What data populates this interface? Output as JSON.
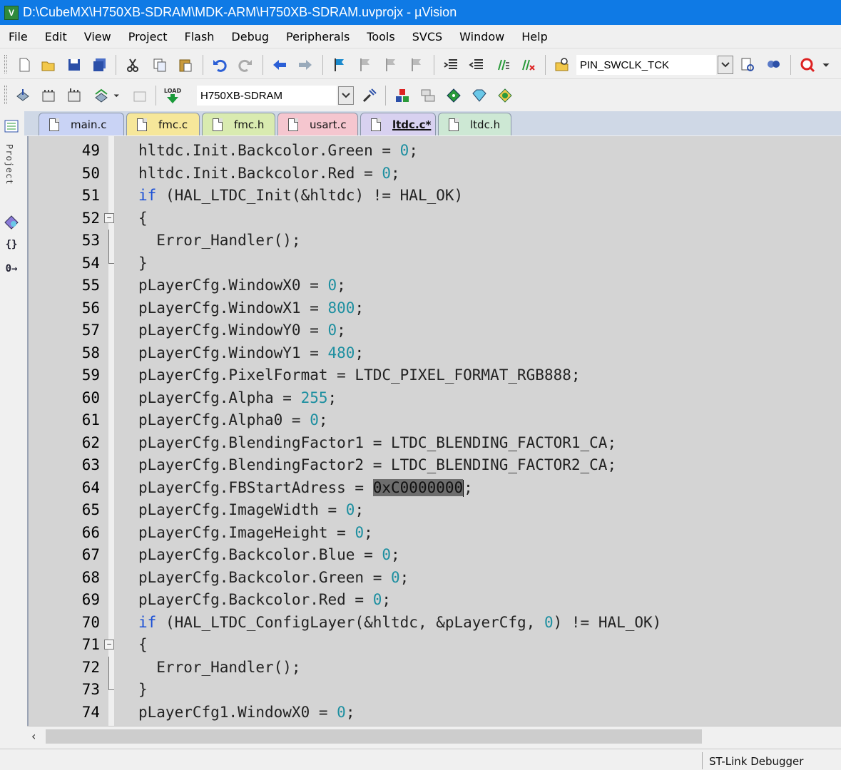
{
  "window": {
    "title": "D:\\CubeMX\\H750XB-SDRAM\\MDK-ARM\\H750XB-SDRAM.uvprojx - µVision",
    "app_icon_letter": "V"
  },
  "menu": [
    "File",
    "Edit",
    "View",
    "Project",
    "Flash",
    "Debug",
    "Peripherals",
    "Tools",
    "SVCS",
    "Window",
    "Help"
  ],
  "toolbar": {
    "find_combo_value": "PIN_SWCLK_TCK",
    "target_combo_value": "H750XB-SDRAM",
    "load_label": "LOAD"
  },
  "sidebar": {
    "project_label": "Project",
    "functions_label": "{}",
    "templates_label": "0→"
  },
  "tabs": [
    {
      "label": "main.c",
      "color": "#c9d3f5",
      "active": false
    },
    {
      "label": "fmc.c",
      "color": "#f6e79a",
      "active": false
    },
    {
      "label": "fmc.h",
      "color": "#d9ebb0",
      "active": false
    },
    {
      "label": "usart.c",
      "color": "#f5c6cf",
      "active": false
    },
    {
      "label": "ltdc.c*",
      "color": "#d8d1f0",
      "active": true
    },
    {
      "label": "ltdc.h",
      "color": "#cde8d4",
      "active": false
    }
  ],
  "code": [
    {
      "ln": "49",
      "text": "hltdc.Init.Backcolor.Green = 0;"
    },
    {
      "ln": "50",
      "text": "hltdc.Init.Backcolor.Red = 0;"
    },
    {
      "ln": "51",
      "text": "if (HAL_LTDC_Init(&hltdc) != HAL_OK)"
    },
    {
      "ln": "52",
      "text": "{"
    },
    {
      "ln": "53",
      "text": "  Error_Handler();"
    },
    {
      "ln": "54",
      "text": "}"
    },
    {
      "ln": "55",
      "text": "pLayerCfg.WindowX0 = 0;"
    },
    {
      "ln": "56",
      "text": "pLayerCfg.WindowX1 = 800;"
    },
    {
      "ln": "57",
      "text": "pLayerCfg.WindowY0 = 0;"
    },
    {
      "ln": "58",
      "text": "pLayerCfg.WindowY1 = 480;"
    },
    {
      "ln": "59",
      "text": "pLayerCfg.PixelFormat = LTDC_PIXEL_FORMAT_RGB888;"
    },
    {
      "ln": "60",
      "text": "pLayerCfg.Alpha = 255;"
    },
    {
      "ln": "61",
      "text": "pLayerCfg.Alpha0 = 0;"
    },
    {
      "ln": "62",
      "text": "pLayerCfg.BlendingFactor1 = LTDC_BLENDING_FACTOR1_CA;"
    },
    {
      "ln": "63",
      "text": "pLayerCfg.BlendingFactor2 = LTDC_BLENDING_FACTOR2_CA;"
    },
    {
      "ln": "64",
      "text": "pLayerCfg.FBStartAdress = 0xC0000000;"
    },
    {
      "ln": "65",
      "text": "pLayerCfg.ImageWidth = 0;"
    },
    {
      "ln": "66",
      "text": "pLayerCfg.ImageHeight = 0;"
    },
    {
      "ln": "67",
      "text": "pLayerCfg.Backcolor.Blue = 0;"
    },
    {
      "ln": "68",
      "text": "pLayerCfg.Backcolor.Green = 0;"
    },
    {
      "ln": "69",
      "text": "pLayerCfg.Backcolor.Red = 0;"
    },
    {
      "ln": "70",
      "text": "if (HAL_LTDC_ConfigLayer(&hltdc, &pLayerCfg, 0) != HAL_OK)"
    },
    {
      "ln": "71",
      "text": "{"
    },
    {
      "ln": "72",
      "text": "  Error_Handler();"
    },
    {
      "ln": "73",
      "text": "}"
    },
    {
      "ln": "74",
      "text": "pLayerCfg1.WindowX0 = 0;"
    }
  ],
  "highlight": {
    "line": "64",
    "token": "0xC0000000"
  },
  "colors": {
    "keyword": "#1a4fd6",
    "number": "#1d8fa0",
    "editor_bg": "#d4d4d4",
    "title_bar": "#0f7ae5"
  },
  "status": {
    "debugger": "ST-Link Debugger"
  }
}
